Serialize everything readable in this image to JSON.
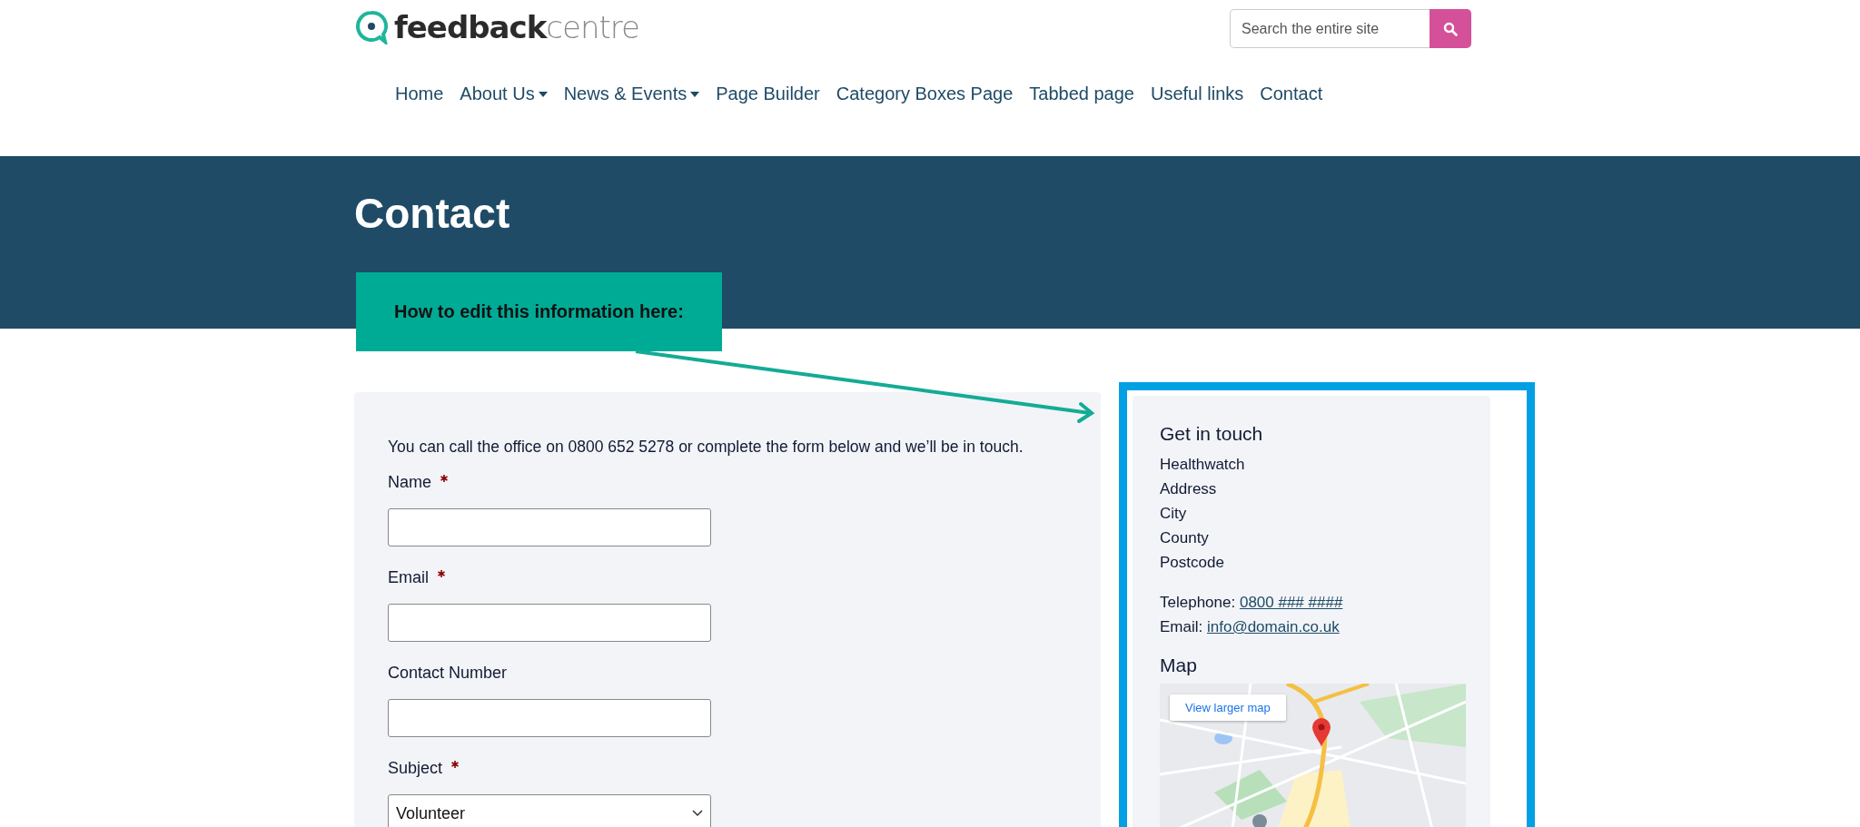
{
  "logo": {
    "bold": "feedback",
    "light": "centre"
  },
  "search": {
    "placeholder": "Search the entire site"
  },
  "nav": [
    {
      "label": "Home",
      "dropdown": false
    },
    {
      "label": "About Us",
      "dropdown": true
    },
    {
      "label": "News & Events",
      "dropdown": true
    },
    {
      "label": "Page Builder",
      "dropdown": false
    },
    {
      "label": "Category Boxes Page",
      "dropdown": false
    },
    {
      "label": "Tabbed page",
      "dropdown": false
    },
    {
      "label": "Useful links",
      "dropdown": false
    },
    {
      "label": "Contact",
      "dropdown": false
    }
  ],
  "page_title": "Contact",
  "callout": "How to edit this information here:",
  "form": {
    "intro": "You can call the office on 0800 652 5278 or complete the form below and we’ll be in touch.",
    "fields": [
      {
        "kind": "text",
        "label": "Name",
        "required": true
      },
      {
        "kind": "text",
        "label": "Email",
        "required": true
      },
      {
        "kind": "text",
        "label": "Contact Number",
        "required": false
      },
      {
        "kind": "select",
        "label": "Subject",
        "required": true,
        "value": "Volunteer"
      }
    ]
  },
  "sidebar": {
    "title": "Get in touch",
    "address": [
      "Healthwatch",
      "Address",
      "City",
      "County",
      "Postcode"
    ],
    "telephone": {
      "label": "Telephone:",
      "link": "0800 ### ####"
    },
    "email": {
      "label": "Email:",
      "link": "info@domain.co.uk"
    },
    "map_title": "Map",
    "map": {
      "kind": "picture",
      "button": "View larger map"
    }
  }
}
